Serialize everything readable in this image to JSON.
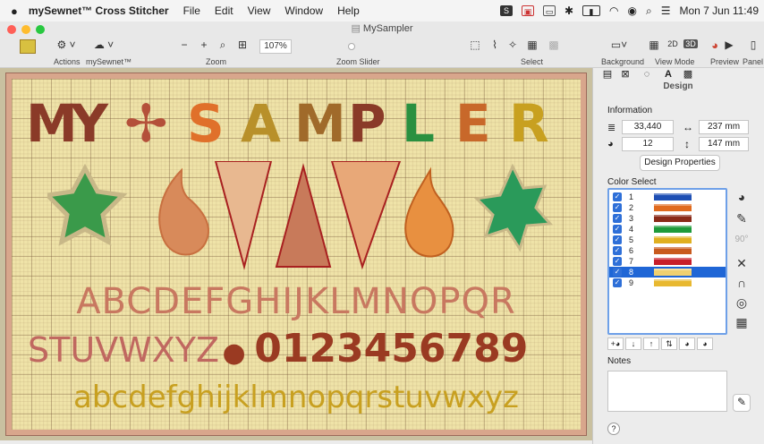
{
  "menubar": {
    "app_name": "mySewnet™ Cross Stitcher",
    "items": [
      "File",
      "Edit",
      "View",
      "Window",
      "Help"
    ],
    "clock": "Mon 7 Jun  11:49"
  },
  "window": {
    "title": "MySampler"
  },
  "toolbar": {
    "actions_label": "Actions",
    "mysewnet_label": "mySewnet™",
    "zoom_label": "Zoom",
    "zoom_value": "107%",
    "zoom_slider_label": "Zoom Slider",
    "zoom_fraction": 0.45,
    "select_label": "Select",
    "background_label": "Background",
    "view_mode_label": "View Mode",
    "view_2d": "2D",
    "view_3d": "3D",
    "preview_label": "Preview",
    "panel_label": "Panel"
  },
  "canvas": {
    "title_letters": [
      "M",
      "Y",
      "✢",
      "S",
      "A",
      "M",
      "P",
      "L",
      "E",
      "R"
    ],
    "title_colors": [
      "#8a3a28",
      "#8a3a28",
      "#b4503a",
      "#e0702a",
      "#b8902a",
      "#a06a2a",
      "#8a3a28",
      "#2a9040",
      "#c8682a",
      "#c8a020"
    ],
    "uppercase_row": "ABCDEFGHIJKLMNOPQR",
    "uppercase_row2": "STUVWXYZ",
    "digits_row": "0123456789",
    "lowercase_row": "abcdefghijklmnopqrstuvwxyz"
  },
  "panel": {
    "tab_design": "Design",
    "information_label": "Information",
    "stitch_count": "33,440",
    "width_value": "237 mm",
    "color_count": "12",
    "height_value": "147 mm",
    "design_properties_button": "Design Properties",
    "color_select_label": "Color Select",
    "colors": [
      {
        "num": "1",
        "color": "#1e4fb4"
      },
      {
        "num": "2",
        "color": "#e06a1e"
      },
      {
        "num": "3",
        "color": "#8a2a18"
      },
      {
        "num": "4",
        "color": "#1e9a3a"
      },
      {
        "num": "5",
        "color": "#e0b020"
      },
      {
        "num": "6",
        "color": "#c85a1e"
      },
      {
        "num": "7",
        "color": "#c81e2a"
      },
      {
        "num": "8",
        "color": "#f0d070"
      },
      {
        "num": "9",
        "color": "#e8b830"
      }
    ],
    "selected_color_index": 7,
    "notes_label": "Notes",
    "help_label": "?"
  }
}
